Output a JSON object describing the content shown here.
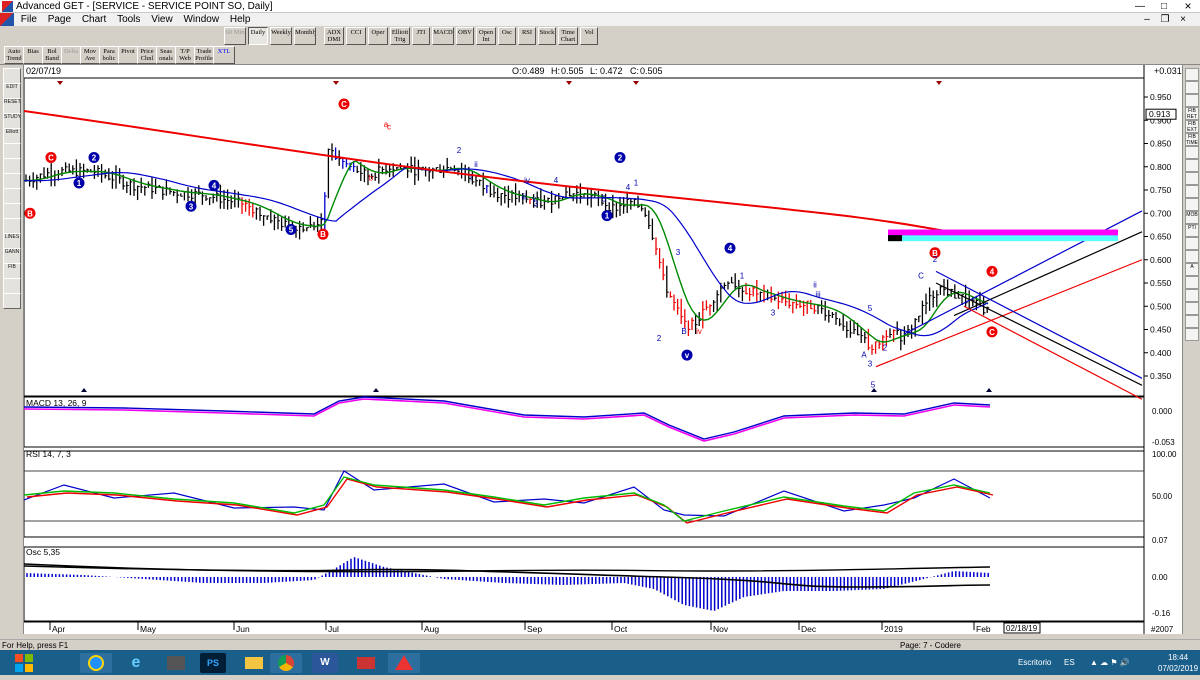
{
  "window": {
    "title": "Advanced GET - [SERVICE - SERVICE POINT SO, Daily]"
  },
  "menu": [
    "File",
    "Page",
    "Chart",
    "Tools",
    "View",
    "Window",
    "Help"
  ],
  "toolbar_top": [
    {
      "label": "60 Min",
      "disabled": true
    },
    {
      "label": "Daily",
      "active": true
    },
    {
      "label": "Weekly"
    },
    {
      "label": "Monthly"
    },
    {
      "label": "ADX DMI"
    },
    {
      "label": "CCI"
    },
    {
      "label": "Oper"
    },
    {
      "label": "Elliott Trig"
    },
    {
      "label": "JTI"
    },
    {
      "label": "MACD"
    },
    {
      "label": "OBV"
    },
    {
      "label": "Open Int"
    },
    {
      "label": "Osc"
    },
    {
      "label": "RSI"
    },
    {
      "label": "Stock"
    },
    {
      "label": "Time Chart"
    },
    {
      "label": "Vol"
    }
  ],
  "toolbar_bottom": [
    {
      "label": "Auto Trend"
    },
    {
      "label": "Bias"
    },
    {
      "label": "Bol Band"
    },
    {
      "label": "Delta",
      "disabled": true
    },
    {
      "label": "Mov Ave"
    },
    {
      "label": "Para bolic"
    },
    {
      "label": "Pivot"
    },
    {
      "label": "Price Chnl"
    },
    {
      "label": "Seas onals"
    },
    {
      "label": "T/P Web"
    },
    {
      "label": "Trade Profile"
    },
    {
      "label": "XTL"
    }
  ],
  "left_tools": [
    "",
    "EDIT",
    "RESET",
    "STUDY",
    "Elliott",
    "",
    "",
    "",
    "",
    "",
    "",
    "LINES",
    "GANN",
    "FIB",
    "",
    ""
  ],
  "right_tools": [
    "",
    "",
    "",
    "FIB RET",
    "FIB EXT",
    "FIB TIME",
    "",
    "",
    "",
    "",
    "",
    "MOB",
    "PTI",
    "",
    "",
    "A",
    "",
    "",
    "",
    "",
    ""
  ],
  "chart": {
    "date": "02/07/19",
    "ohlc": {
      "open_label": "O:",
      "open": "0.489",
      "high_label": "H:",
      "high": "0.505",
      "low_label": "L:",
      "low": "0.472",
      "close_label": "C:",
      "close": "0.505"
    },
    "change": "+0.031",
    "current_price": "0.913",
    "price_axis": [
      "0.950",
      "0.900",
      "0.850",
      "0.800",
      "0.750",
      "0.700",
      "0.650",
      "0.600",
      "0.550",
      "0.500",
      "0.450",
      "0.400",
      "0.350"
    ],
    "macd_label": "MACD 13, 26, 9",
    "macd_axis": [
      "0.000",
      "-0.053"
    ],
    "rsi_label": "RSI 14, 7, 3",
    "rsi_axis": [
      "100.00",
      "50.00",
      "0.07"
    ],
    "osc_label": "Osc 5,35",
    "osc_axis": [
      "0.00",
      "-0.16"
    ],
    "months": [
      "Apr",
      "May",
      "Jun",
      "Jul",
      "Aug",
      "Sep",
      "Oct",
      "Nov",
      "Dec",
      "2019",
      "Feb"
    ],
    "date_box": "02/18/19",
    "bar_count": "#2007",
    "wave_labels": [
      "C",
      "2",
      "1",
      "B",
      "4",
      "3",
      "5",
      "B",
      "C",
      "a",
      "b",
      "c",
      "2",
      "ii",
      "i",
      "iv",
      "iii",
      "v",
      "3",
      "4",
      "5",
      "1",
      "2",
      "1",
      "4",
      "3",
      "2",
      "B",
      "4",
      "3",
      "ii",
      "iv",
      "v",
      "iii",
      "5",
      "3",
      "A",
      "5",
      "C",
      "B",
      "2",
      "4"
    ]
  },
  "status": {
    "left": "For Help, press F1",
    "page": "Page: 7 - Codere"
  },
  "taskbar": {
    "apps": [
      "IE",
      "PS",
      "",
      "Chrome",
      "W",
      "",
      "",
      ""
    ],
    "desktop": "Escritorio",
    "lang": "ES",
    "time": "18:44",
    "date": "07/02/2019"
  }
}
